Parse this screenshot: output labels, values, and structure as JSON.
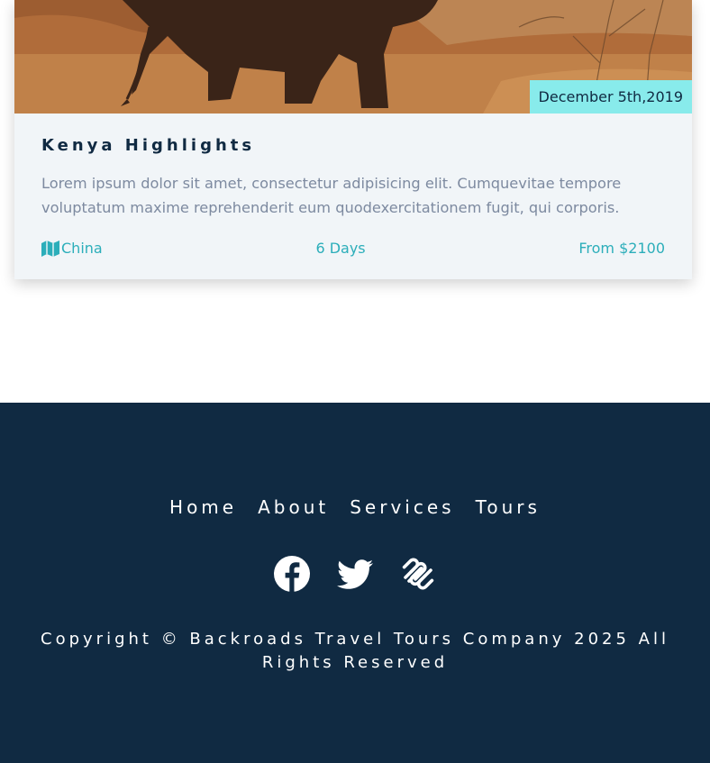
{
  "tour": {
    "date": "December 5th,2019",
    "title": "Kenya Highlights",
    "description": "Lorem ipsum dolor sit amet, consectetur adipisicing elit. Cumquevitae tempore voluptatum maxime reprehenderit eum quodexercitationem fugit, qui corporis.",
    "country": "China",
    "duration": "6 Days",
    "price": "From $2100"
  },
  "footer": {
    "links": [
      "Home",
      "About",
      "Services",
      "Tours"
    ],
    "social_icons": [
      "facebook-icon",
      "twitter-icon",
      "squarespace-icon"
    ],
    "copyright": "Copyright © Backroads Travel Tours Company 2025 All Rights Reserved"
  },
  "colors": {
    "primary": "#2caeba",
    "date_badge": "#88ebeb",
    "dark": "#102a42",
    "card_bg": "#f1f5f8"
  }
}
